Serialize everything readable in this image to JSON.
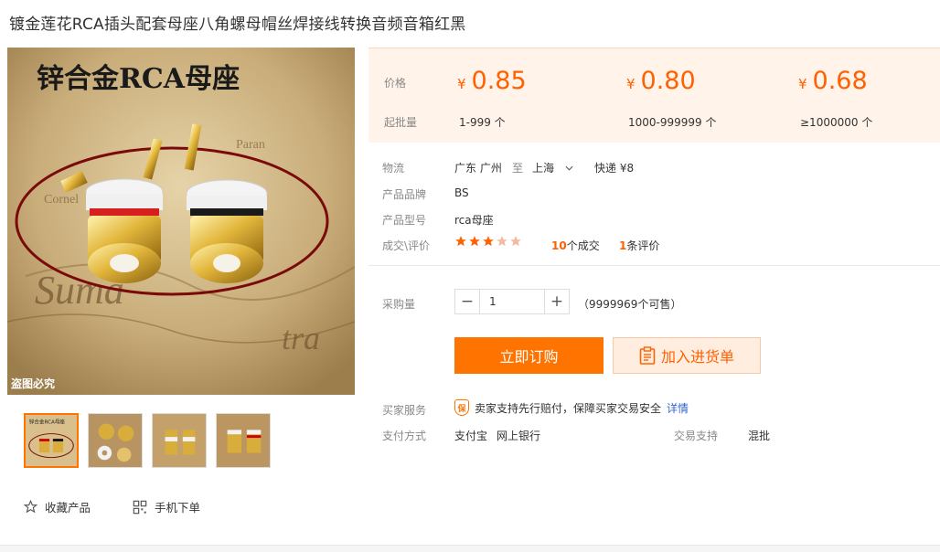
{
  "title": "镀金莲花RCA插头配套母座八角螺母帽丝焊接线转换音频音箱红黑",
  "image": {
    "caption": "锌合金RCA母座",
    "watermark": "盗图必究"
  },
  "thumbs": [
    {
      "caption": "锌合金RCA母座"
    },
    {},
    {},
    {}
  ],
  "actions": {
    "favorite": "收藏产品",
    "mobile": "手机下单"
  },
  "price_panel": {
    "price_label": "价格",
    "moq_label": "起批量",
    "currency": "¥",
    "tiers": [
      {
        "price": "0.85",
        "range": "1-999 个"
      },
      {
        "price": "0.80",
        "range": "1000-999999 个"
      },
      {
        "price": "0.68",
        "range": "≥1000000 个"
      }
    ]
  },
  "logistics": {
    "label": "物流",
    "from": "广东 广州",
    "to_word": "至",
    "to": "上海",
    "shipping": "快递 ¥8"
  },
  "brand": {
    "label": "产品品牌",
    "value": "BS"
  },
  "model": {
    "label": "产品型号",
    "value": "rca母座"
  },
  "reviews": {
    "label": "成交\\评价",
    "rating": 3,
    "max": 5,
    "deals_count": "10",
    "deals_suffix": "个成交",
    "review_count": "1",
    "review_suffix": "条评价"
  },
  "quantity": {
    "label": "采购量",
    "value": "1",
    "minus": "−",
    "plus": "+",
    "stock": "（9999969个可售）"
  },
  "buttons": {
    "buy": "立即订购",
    "cart": "加入进货单"
  },
  "service": {
    "label": "买家服务",
    "badge": "保",
    "text": "卖家支持先行赔付，保障买家交易安全",
    "link": "详情"
  },
  "payment": {
    "label": "支付方式",
    "methods": [
      "支付宝",
      "网上银行"
    ],
    "trade_label": "交易支持",
    "trade_value": "混批"
  },
  "colors": {
    "accent": "#ff7300",
    "price": "#ff6000",
    "panel_bg": "#fff3ea"
  }
}
